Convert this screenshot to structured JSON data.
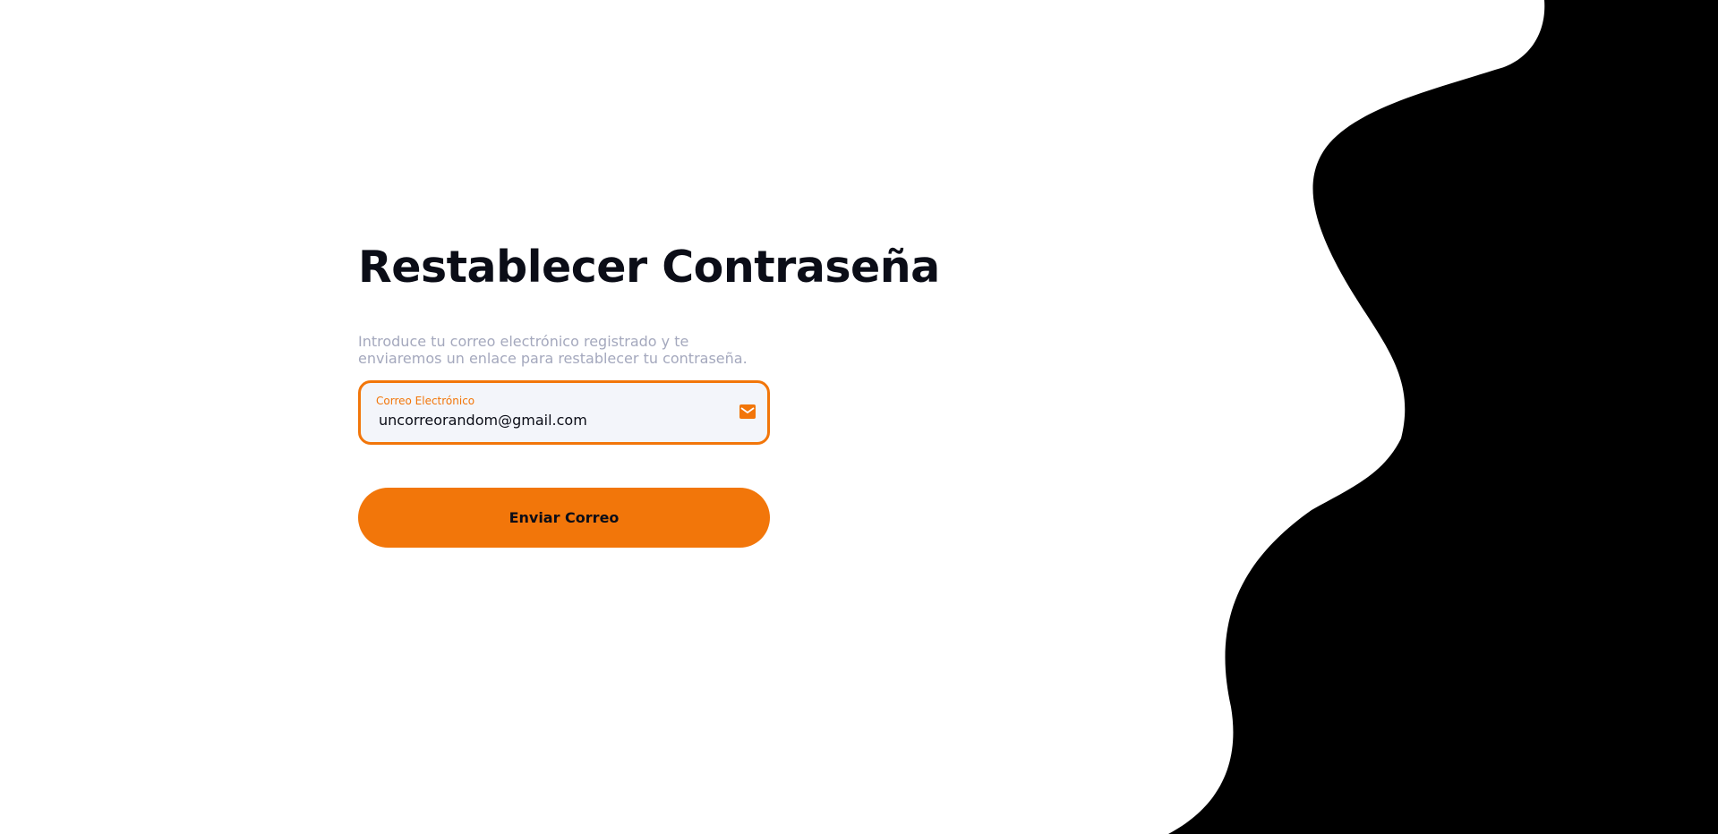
{
  "page": {
    "title": "Restablecer Contraseña",
    "description": "Introduce tu correo electrónico registrado y te enviaremos un enlace para restablecer tu contraseña."
  },
  "form": {
    "email": {
      "label": "Correo Electrónico",
      "value": "uncorreorandom@gmail.com",
      "icon": "mail-icon"
    },
    "submit_label": "Enviar Correo"
  },
  "colors": {
    "accent": "#f2760a",
    "background": "#ffffff",
    "decoration": "#000000",
    "title": "#0b0d17",
    "muted_text": "#a4a8bd",
    "input_background": "#f3f5fa"
  }
}
